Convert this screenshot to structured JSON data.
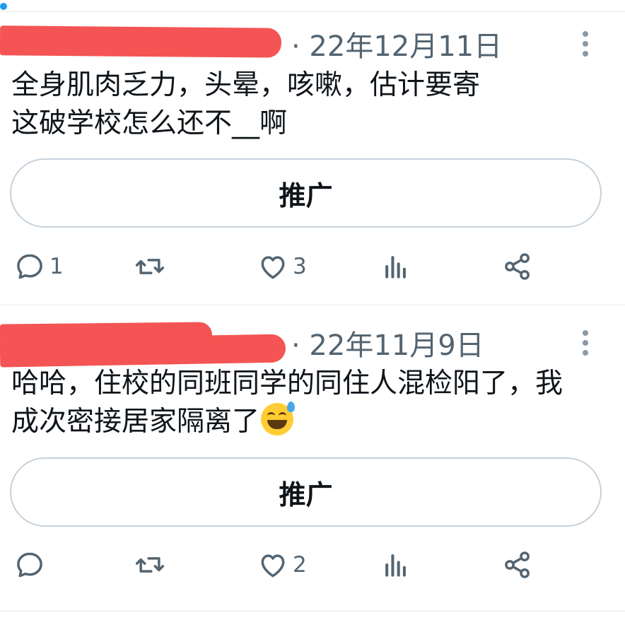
{
  "tweets": [
    {
      "date_text": "· 22年12月11日",
      "lines": [
        "全身肌肉乏力，头晕，咳嗽，估计要寄",
        "这破学校怎么还不__啊"
      ],
      "emoji": "",
      "promote_label": "推广",
      "reply_count": "1",
      "retweet_count": "",
      "like_count": "3"
    },
    {
      "date_text": "· 22年11月9日",
      "lines": [
        "哈哈，住校的同班同学的同住人混检阳了，我",
        "成次密接居家隔离了"
      ],
      "emoji": "grinning-sweat-emoji",
      "promote_label": "推广",
      "reply_count": "",
      "retweet_count": "",
      "like_count": "2"
    }
  ],
  "colors": {
    "accent": "#1d9bf0",
    "muted_text": "#536471",
    "redaction": "#f45454",
    "border": "#c6d1da"
  },
  "icons": [
    "more-vertical-icon",
    "reply-icon",
    "retweet-icon",
    "like-icon",
    "views-icon",
    "share-icon"
  ]
}
